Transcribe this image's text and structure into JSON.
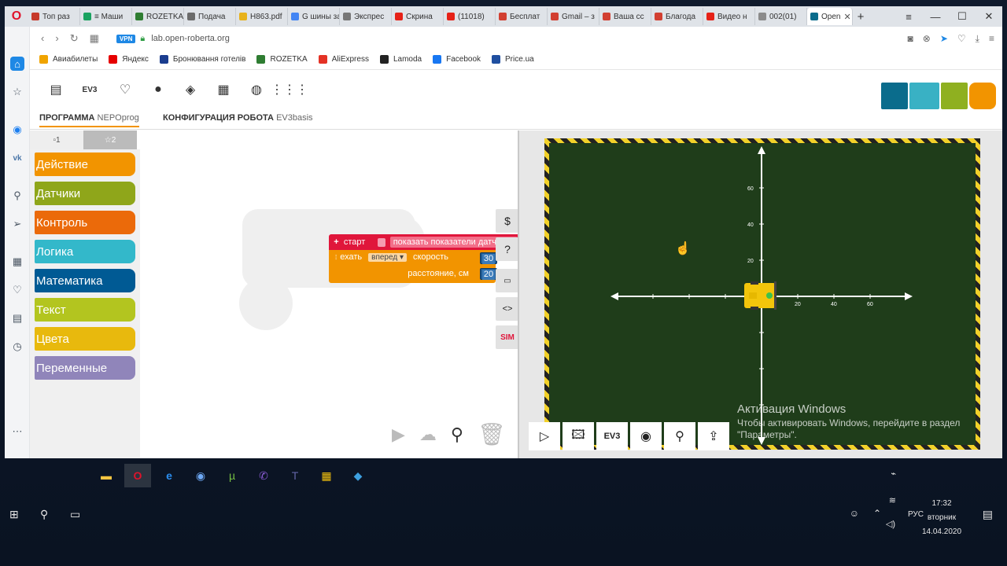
{
  "browser": {
    "tabs": [
      {
        "label": "Топ раз",
        "color": "#c6392a",
        "icon": "kp-icon"
      },
      {
        "label": "≡ Маши",
        "color": "#1aa260",
        "icon": "grid-icon"
      },
      {
        "label": "ROZETKA",
        "color": "#2f7d32",
        "icon": "rozetka-icon"
      },
      {
        "label": "Подача",
        "color": "#6b6b6b",
        "icon": "tool-icon"
      },
      {
        "label": "H863.pdf",
        "color": "#e8b21b",
        "icon": "pdf-icon"
      },
      {
        "label": "G шины за",
        "color": "#4285f4",
        "icon": "google-icon"
      },
      {
        "label": "Экспрес",
        "color": "#777777",
        "icon": "grid-icon"
      },
      {
        "label": "Скрина",
        "color": "#e62117",
        "icon": "youtube-icon"
      },
      {
        "label": "(11018)",
        "color": "#e62117",
        "icon": "youtube-icon"
      },
      {
        "label": "Бесплат",
        "color": "#d23f31",
        "icon": "puzzle-icon"
      },
      {
        "label": "Gmail – з",
        "color": "#d23f31",
        "icon": "gmail-icon"
      },
      {
        "label": "Ваша сс",
        "color": "#d23f31",
        "icon": "gmail-icon"
      },
      {
        "label": "Благода",
        "color": "#d23f31",
        "icon": "puzzle-icon"
      },
      {
        "label": "Видео н",
        "color": "#e62117",
        "icon": "youtube-icon"
      },
      {
        "label": "002(01)",
        "color": "#8b8b8b",
        "icon": "file-icon"
      },
      {
        "label": "Open",
        "color": "#0a6c8c",
        "icon": "roberta-icon",
        "active": true
      }
    ],
    "window_controls": [
      "≡",
      "—",
      "☐",
      "✕"
    ],
    "url": "lab.open-roberta.org",
    "vpn": "VPN",
    "bookmarks": [
      {
        "label": "Авиабилеты",
        "color": "#f0a400",
        "icon": "plane-icon"
      },
      {
        "label": "Яндекс",
        "color": "#e60000",
        "icon": "yandex-icon"
      },
      {
        "label": "Бронювання готелів",
        "color": "#1b3d8f",
        "icon": "booking-icon"
      },
      {
        "label": "ROZETKA",
        "color": "#2f7d32",
        "icon": "rozetka-icon"
      },
      {
        "label": "AliExpress",
        "color": "#e43225",
        "icon": "aliexpress-icon"
      },
      {
        "label": "Lamoda",
        "color": "#222222",
        "icon": "lamoda-icon"
      },
      {
        "label": "Facebook",
        "color": "#1877f2",
        "icon": "facebook-icon"
      },
      {
        "label": "Price.ua",
        "color": "#1f4fa0",
        "icon": "price-icon"
      }
    ]
  },
  "app": {
    "toolbar_ev3": "EV3",
    "tabs": [
      {
        "bold": "ПРОГРАММА",
        "rest": "NEPOprog"
      },
      {
        "bold": "КОНФИГУРАЦИЯ РОБОТА",
        "rest": "EV3basis"
      }
    ],
    "nepo_colors": [
      "#0a6c8c",
      "#39b1c4",
      "#8fb020",
      "#f29400"
    ],
    "flyout_tabs": [
      "▫1",
      "☆2"
    ],
    "categories": [
      {
        "label": "Действие",
        "color": "#f29400"
      },
      {
        "label": "Датчики",
        "color": "#8fa61a"
      },
      {
        "label": "Контроль",
        "color": "#eb6a0a"
      },
      {
        "label": "Логика",
        "color": "#33b8ca"
      },
      {
        "label": "Математика",
        "color": "#005a94"
      },
      {
        "label": "Текст",
        "color": "#b3c51f"
      },
      {
        "label": "Цвета",
        "color": "#e8b90d"
      },
      {
        "label": "Переменные",
        "color": "#9085ba"
      }
    ],
    "blocks": {
      "start_label": "старт",
      "show_label": "показать показатели датчиков",
      "drive_label": "ехать",
      "direction": "вперед",
      "speed_label": "скорость",
      "speed": "30",
      "distance_label": "расстояние, см",
      "distance": "20"
    },
    "side_tools": [
      "$",
      "?",
      "▭",
      "<>",
      "SIM"
    ],
    "sim_buttons": [
      "▷",
      "🖾",
      "EV3",
      "◉",
      "⚲",
      "⇪"
    ],
    "axis": {
      "y_ticks": [
        "60",
        "40",
        "20"
      ],
      "x_ticks": [
        "20",
        "40",
        "60"
      ]
    }
  },
  "overlay": {
    "activation_title": "Активация Windows",
    "activation_text": "Чтобы активировать Windows, перейдите в раздел \"Параметры\"."
  },
  "taskbar": {
    "lang": "РУС",
    "time": "17:32",
    "day": "вторник",
    "date": "14.04.2020"
  }
}
